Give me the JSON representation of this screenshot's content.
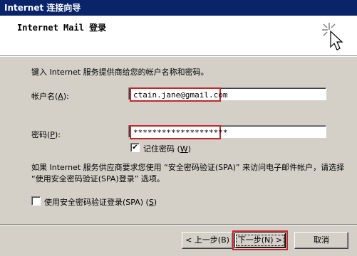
{
  "window": {
    "title": "Internet 连接向导"
  },
  "header": {
    "title": "Internet Mail 登录",
    "icon": "wizard-sparkle-cursor-icon"
  },
  "content": {
    "instruction": "键入 Internet 服务提供商给您的帐户名称和密码。",
    "account_label": "帐户名(",
    "account_key": "A",
    "account_label_end": "):",
    "account_value": "ctain.jane@gmail.com",
    "password_label": "密码(",
    "password_key": "P",
    "password_label_end": "):",
    "password_value": "********************",
    "remember_password": {
      "label": "记住密码 (",
      "key": "W",
      "label_end": ")",
      "checked": true,
      "check_glyph": "✔"
    },
    "spa_paragraph": "如果 Internet 服务供应商要求您使用 “安全密码验证(SPA)” 来访问电子邮件帐户，请选择 “使用安全密码验证(SPA)登录” 选项。",
    "spa_checkbox": {
      "label": "使用安全密码验证登录(SPA) (",
      "key": "S",
      "label_end": ")",
      "checked": false
    }
  },
  "buttons": {
    "back": "< 上一步(B)",
    "next": "下一步(N) >",
    "cancel": "取消"
  },
  "colors": {
    "title_bar": "#0a246a",
    "dialog_face": "#d4d0c8",
    "highlight": "#c0282d"
  }
}
